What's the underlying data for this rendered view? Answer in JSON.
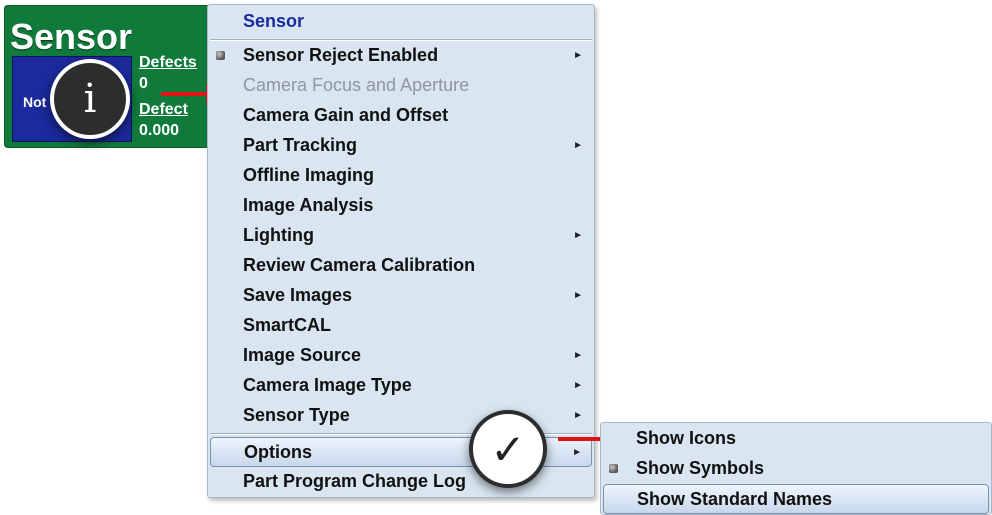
{
  "sensor_widget": {
    "title": "Sensor",
    "status_text": "Not",
    "defects_label": "Defects",
    "defects_value": "0",
    "defect_area_label": "Defect",
    "defect_area_value": "0.000",
    "background_color": "#0f7a3a",
    "status_color": "#1b2a9c"
  },
  "badges": {
    "info_glyph": "i",
    "check_glyph": "✓"
  },
  "context_menu": {
    "header": "Sensor",
    "items": [
      {
        "label": "Sensor Reject Enabled",
        "submenu": true,
        "checked": true,
        "enabled": true
      },
      {
        "label": "Camera Focus and Aperture",
        "submenu": false,
        "checked": false,
        "enabled": false
      },
      {
        "label": "Camera Gain and Offset",
        "submenu": false,
        "checked": false,
        "enabled": true
      },
      {
        "label": "Part Tracking",
        "submenu": true,
        "checked": false,
        "enabled": true
      },
      {
        "label": "Offline Imaging",
        "submenu": false,
        "checked": false,
        "enabled": true
      },
      {
        "label": "Image Analysis",
        "submenu": false,
        "checked": false,
        "enabled": true
      },
      {
        "label": "Lighting",
        "submenu": true,
        "checked": false,
        "enabled": true
      },
      {
        "label": "Review Camera Calibration",
        "submenu": false,
        "checked": false,
        "enabled": true
      },
      {
        "label": "Save Images",
        "submenu": true,
        "checked": false,
        "enabled": true
      },
      {
        "label": "SmartCAL",
        "submenu": false,
        "checked": false,
        "enabled": true
      },
      {
        "label": "Image Source",
        "submenu": true,
        "checked": false,
        "enabled": true
      },
      {
        "label": "Camera Image Type",
        "submenu": true,
        "checked": false,
        "enabled": true
      },
      {
        "label": "Sensor Type",
        "submenu": true,
        "checked": false,
        "enabled": true
      },
      {
        "label": "Options",
        "submenu": true,
        "checked": false,
        "enabled": true,
        "selected": true
      },
      {
        "label": "Part Program Change Log",
        "submenu": false,
        "checked": false,
        "enabled": true
      }
    ],
    "submenu_arrow": "►"
  },
  "options_submenu": {
    "items": [
      {
        "label": "Show Icons",
        "checked": false
      },
      {
        "label": "Show Symbols",
        "checked": true
      },
      {
        "label": "Show Standard Names",
        "checked": false,
        "selected": true
      }
    ]
  },
  "colors": {
    "menu_background": "#d9e6f2",
    "header_text": "#1a2aa0",
    "arrow_red": "#e01414",
    "disabled_text": "#8f969e"
  }
}
